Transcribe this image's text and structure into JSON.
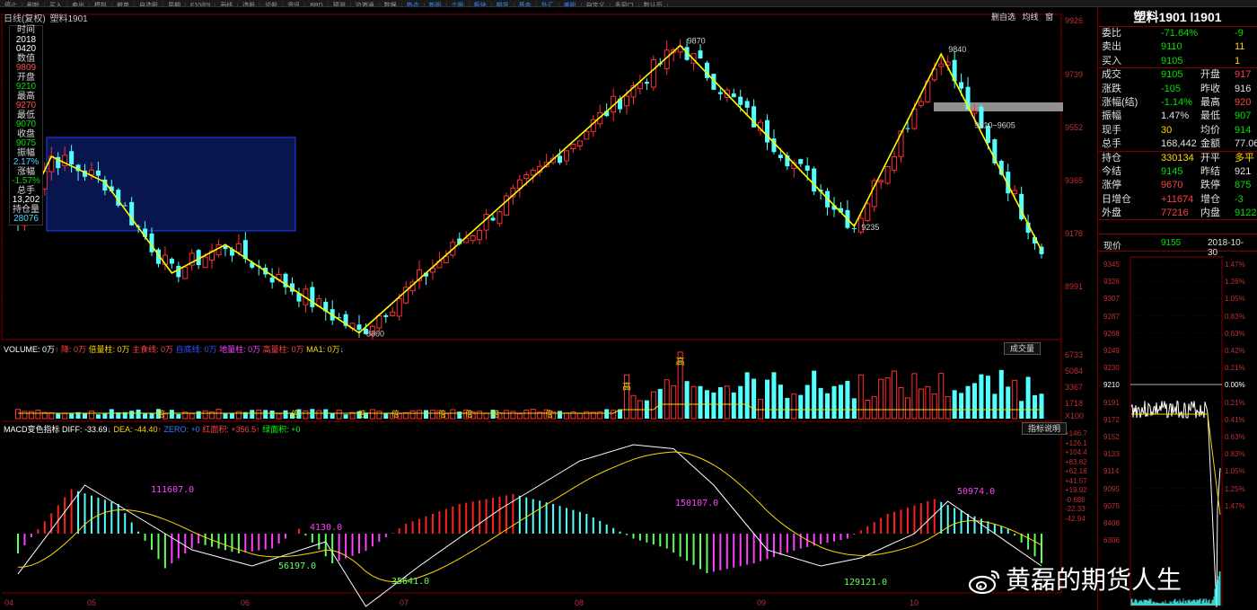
{
  "toolbar": {
    "items": [
      "停止",
      "刷新",
      "买入",
      "卖出",
      "模拟",
      "撤单",
      "自选股",
      "周期",
      "F10/F9",
      "画线",
      "选股",
      "论股",
      "资讯"
    ],
    "tabs": [
      "BBD",
      "预测",
      "沪港通",
      "数据",
      "热点",
      "新股",
      "个股",
      "板块",
      "期货",
      "基金",
      "外汇",
      "美股",
      "自定义",
      "多窗口",
      "数认页"
    ]
  },
  "chart": {
    "title_prefix": "日线(复权)",
    "symbol": "塑料1901",
    "right_buttons": [
      "删自选",
      "均线",
      "窗"
    ],
    "price_axis": [
      "9926",
      "9739",
      "9552",
      "9365",
      "9178",
      "8991"
    ],
    "info": {
      "time_label": "时间",
      "time_year": "2018",
      "time_date": "0420",
      "value_label": "数值",
      "value": "9809",
      "open_label": "开盘",
      "open": "9210",
      "high_label": "最高",
      "high": "9270",
      "low_label": "最低",
      "low": "9070",
      "close_label": "收盘",
      "close": "9075",
      "amp_label": "振幅",
      "amp": "2.17%",
      "chg_label": "涨幅",
      "chg": "-1.57%",
      "vol_label": "总手",
      "vol": "13,202",
      "oi_label": "持仓量",
      "oi": "28076"
    },
    "annotations": {
      "peak1": "9870",
      "peak2": "9840",
      "low1": "8860",
      "low2": "9235",
      "range": "9610~9605"
    },
    "x_labels": [
      "04",
      "05",
      "06",
      "07",
      "08",
      "09",
      "10"
    ]
  },
  "volume": {
    "header": [
      {
        "t": "VOLUME: 0万",
        "c": "#ffffff"
      },
      {
        "t": "↑",
        "c": "#ff4040"
      },
      {
        "t": " 降: 0万",
        "c": "#ff4040"
      },
      {
        "t": " 倍量柱: 0万",
        "c": "#ffd700"
      },
      {
        "t": " 主食线: 0万",
        "c": "#ff4040"
      },
      {
        "t": " 自底线: 0万",
        "c": "#3050ff"
      },
      {
        "t": " 地量柱: 0万",
        "c": "#ff40ff"
      },
      {
        "t": " 高量柱: 0万",
        "c": "#ff4040"
      },
      {
        "t": " MA1: 0万",
        "c": "#ffd700"
      },
      {
        "t": "↓",
        "c": "#4fd8ff"
      }
    ],
    "button": "成交量",
    "axis": [
      "6733",
      "5084",
      "3367",
      "1718",
      "X100"
    ],
    "marks": {
      "high": "高",
      "double": "倍"
    }
  },
  "macd": {
    "header": [
      {
        "t": "MACD变色指标 DIFF: -33.69",
        "c": "#ffffff"
      },
      {
        "t": "↓",
        "c": "#4fd8ff"
      },
      {
        "t": " DEA: -44.40",
        "c": "#ffd700"
      },
      {
        "t": "↑",
        "c": "#ff4040"
      },
      {
        "t": " ZERO: +0",
        "c": "#3080ff"
      },
      {
        "t": " 红面积: +356.5",
        "c": "#ff4040"
      },
      {
        "t": "↑",
        "c": "#ff4040"
      },
      {
        "t": " 绿面积: +0",
        "c": "#00ff00"
      }
    ],
    "button": "指标说明",
    "axis": [
      "+146.7",
      "+126.1",
      "+104.4",
      "+83.82",
      "+62.18",
      "+41.57",
      "+19.92",
      "-0.686",
      "-22.33",
      "-42.94"
    ],
    "areas": [
      "111607.0",
      "4130.0",
      "56197.0",
      "35641.0",
      "150107.0",
      "129121.0",
      "50974.0"
    ]
  },
  "quote": {
    "title": "塑料1901 l1901",
    "rows": [
      {
        "l": "委比",
        "v": "-71.64%",
        "v2": "-9",
        "c": "grn",
        "c2": "grn"
      },
      {
        "l": "卖出",
        "v": "9110",
        "v2": "11",
        "c": "grn",
        "c2": "yel"
      },
      {
        "l": "买入",
        "v": "9105",
        "v2": "1",
        "c": "grn",
        "c2": "yel"
      },
      {
        "l": "成交",
        "v": "9105",
        "m": "开盘",
        "v2": "917",
        "c": "grn",
        "c2": "red"
      },
      {
        "l": "涨跌",
        "v": "-105",
        "m": "昨收",
        "v2": "916",
        "c": "grn",
        "c2": "wht"
      },
      {
        "l": "涨幅(结)",
        "v": "-1.14%",
        "m": "最高",
        "v2": "920",
        "c": "grn",
        "c2": "red"
      },
      {
        "l": "振幅",
        "v": "1.47%",
        "m": "最低",
        "v2": "907",
        "c": "wht",
        "c2": "grn"
      },
      {
        "l": "现手",
        "v": "30",
        "m": "均价",
        "v2": "914",
        "c": "yel",
        "c2": "grn"
      },
      {
        "l": "总手",
        "v": "168,442",
        "m": "金额",
        "v2": "77.06",
        "c": "wht",
        "c2": "wht"
      },
      {
        "l": "持仓",
        "v": "330134",
        "m": "开平",
        "v2": "多平",
        "c": "yel",
        "c2": "yel"
      },
      {
        "l": "今结",
        "v": "9145",
        "m": "昨结",
        "v2": "921",
        "c": "grn",
        "c2": "wht"
      },
      {
        "l": "涨停",
        "v": "9670",
        "m": "跌停",
        "v2": "875",
        "c": "red",
        "c2": "grn"
      },
      {
        "l": "日增仓",
        "v": "+11674",
        "m": "增仓",
        "v2": "-3",
        "c": "red",
        "c2": "grn"
      },
      {
        "l": "外盘",
        "v": "77216",
        "m": "内盘",
        "v2": "9122",
        "c": "red",
        "c2": "grn"
      }
    ],
    "now_label": "现价",
    "now_price": "9155",
    "now_time": "2018-10-30_"
  },
  "mini_chart": {
    "left_axis": [
      "9345",
      "9326",
      "9307",
      "9287",
      "9268",
      "9249",
      "9230",
      "9210",
      "9191",
      "9172",
      "9152",
      "9133",
      "9114",
      "9095",
      "9075",
      "8408",
      "6306"
    ],
    "right_axis": [
      "1.47%",
      "1.26%",
      "1.05%",
      "0.83%",
      "0.63%",
      "0.42%",
      "0.21%",
      "0.00%",
      "0.21%",
      "0.41%",
      "0.63%",
      "0.83%",
      "1.05%",
      "1.25%",
      "1.47%"
    ]
  },
  "watermark": "黄磊的期货人生"
}
